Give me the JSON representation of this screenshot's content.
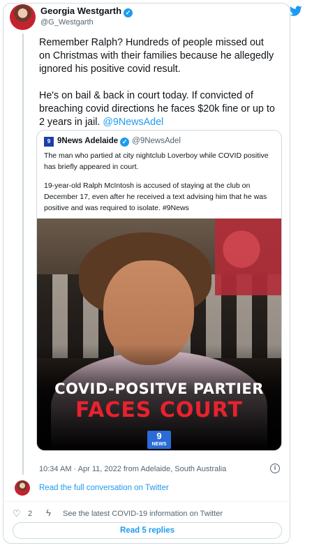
{
  "author": {
    "name": "Georgia Westgarth",
    "handle": "@G_Westgarth",
    "verified_mark": "✓"
  },
  "tweet": {
    "paragraph1": "Remember Ralph? Hundreds of people missed out on Christmas with their families because he allegedly ignored his positive covid result.",
    "paragraph2_text": "He's on bail & back in court today. If convicted of breaching covid directions he faces $20k fine or up to 2 years in jail. ",
    "paragraph2_mention": "@9NewsAdel"
  },
  "quote": {
    "logo_text": "9",
    "name": "9News Adelaide",
    "handle": "@9NewsAdel",
    "paragraph1": "The man who partied at city nightclub Loverboy while COVID positive has briefly appeared in court.",
    "paragraph2": "19-year-old Ralph McIntosh is accused of staying at the club on December 17, even after he received a text advising him that he was positive and was required to isolate. #9News",
    "media": {
      "headline_line1": "COVID-POSITVE PARTIER",
      "headline_line2": "FACES COURT",
      "logo_line1": "9",
      "logo_line2": "NEWS"
    }
  },
  "timestamp": "10:34 AM · Apr 11, 2022 from Adelaide, South Australia",
  "info_icon_glyph": "i",
  "full_conversation": "Read the full conversation on Twitter",
  "actions": {
    "like_icon": "♡",
    "like_count": "2",
    "bolt_icon": "ϟ",
    "covid_info": "See the latest COVID-19 information on Twitter"
  },
  "read_replies": "Read 5 replies",
  "colors": {
    "accent": "#1d9bf0",
    "headline_red": "#e8222e",
    "text": "#0f1419",
    "muted": "#536471"
  }
}
